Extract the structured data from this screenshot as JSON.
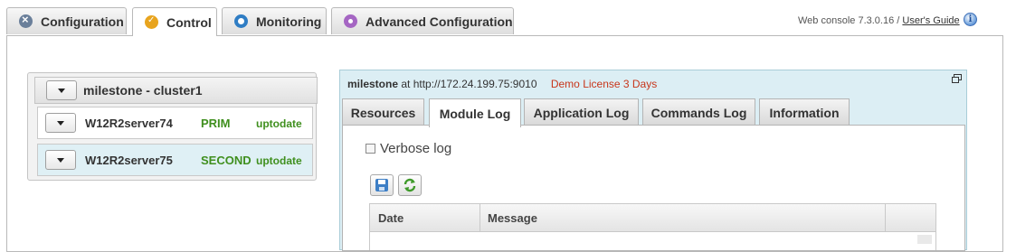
{
  "main_tabs": [
    {
      "label": "Configuration",
      "icon": "configuration-icon"
    },
    {
      "label": "Control",
      "icon": "control-icon",
      "active": true
    },
    {
      "label": "Monitoring",
      "icon": "monitoring-icon"
    },
    {
      "label": "Advanced Configuration",
      "icon": "advanced-configuration-icon"
    }
  ],
  "header": {
    "version_text": "Web console 7.3.0.16 /",
    "guide_link": "User's Guide",
    "info_icon": "info-icon"
  },
  "cluster": {
    "title": "milestone - cluster1",
    "servers": [
      {
        "name": "W12R2server74",
        "role": "PRIM",
        "status": "uptodate",
        "selected": false
      },
      {
        "name": "W12R2server75",
        "role": "SECOND",
        "status": "uptodate",
        "selected": true
      }
    ]
  },
  "detail": {
    "server_name": "milestone",
    "at_text": "at http://172.24.199.75:9010",
    "license_text": "Demo License 3 Days",
    "tabs": [
      {
        "label": "Resources"
      },
      {
        "label": "Module Log",
        "active": true
      },
      {
        "label": "Application Log"
      },
      {
        "label": "Commands Log"
      },
      {
        "label": "Information"
      }
    ],
    "verbose_label": "Verbose log",
    "verbose_checked": false,
    "toolbar": {
      "save_icon": "save-icon",
      "refresh_icon": "refresh-icon"
    },
    "grid_columns": [
      "Date",
      "Message",
      ""
    ]
  },
  "colors": {
    "accent_green": "#3f8f1e",
    "license_red": "#c8361b",
    "panel_blue": "#dceef4"
  }
}
